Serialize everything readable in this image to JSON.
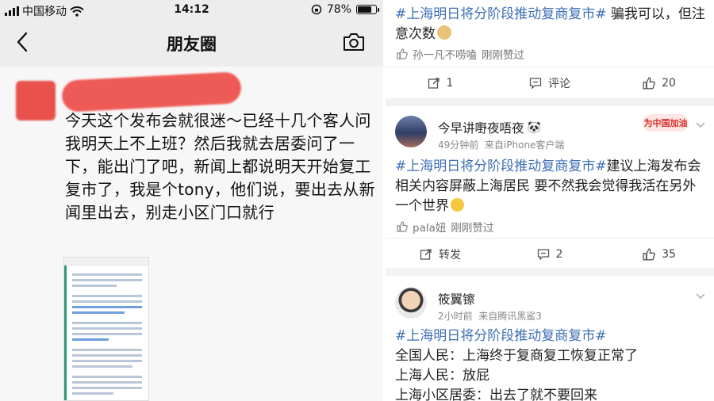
{
  "left": {
    "status": {
      "carrier": "中国移动",
      "time": "14:12",
      "battery": "78%",
      "battery_level": 0.78
    },
    "nav": {
      "title": "朋友圈"
    },
    "post": {
      "text": "今天这个发布会就很迷～已经十几个客人问我明天上不上班？然后我就去居委问了一下，能出门了吧，新闻上都说明天开始复工复市了，我是个tony，他们说，要出去从新闻里出去，别走小区门口就行"
    }
  },
  "right": {
    "card1": {
      "hashtag": "#上海明日将分阶段推动复商复市#",
      "body": " 骗我可以，但注意次数",
      "liked_by": "孙一凡不唠嗑",
      "liked_time": "刚刚赞过",
      "repost_count": "1",
      "comment_label": "评论",
      "like_count": "20"
    },
    "card2": {
      "username": "今早讲嘢夜唔夜",
      "time": "49分钟前",
      "source": "来自iPhone客户端",
      "badge": "为中国加油",
      "hashtag": "#上海明日将分阶段推动复商复市#",
      "body": "建议上海发布会相关内容屏蔽上海居民 要不然我会觉得我活在另外一个世界",
      "liked_by": "pala妞",
      "liked_time": "刚刚赞过",
      "repost_label": "转发",
      "comment_count": "2",
      "like_count": "35"
    },
    "card3": {
      "username": "筱翼镲",
      "time": "2小时前",
      "source": "来自腾讯黑鲨3",
      "hashtag": "#上海明日将分阶段推动复商复市#",
      "lines": [
        "全国人民：上海终于复商复工恢复正常了",
        "上海人民：放屁",
        "上海小区居委：出去了就不要回来"
      ]
    }
  }
}
